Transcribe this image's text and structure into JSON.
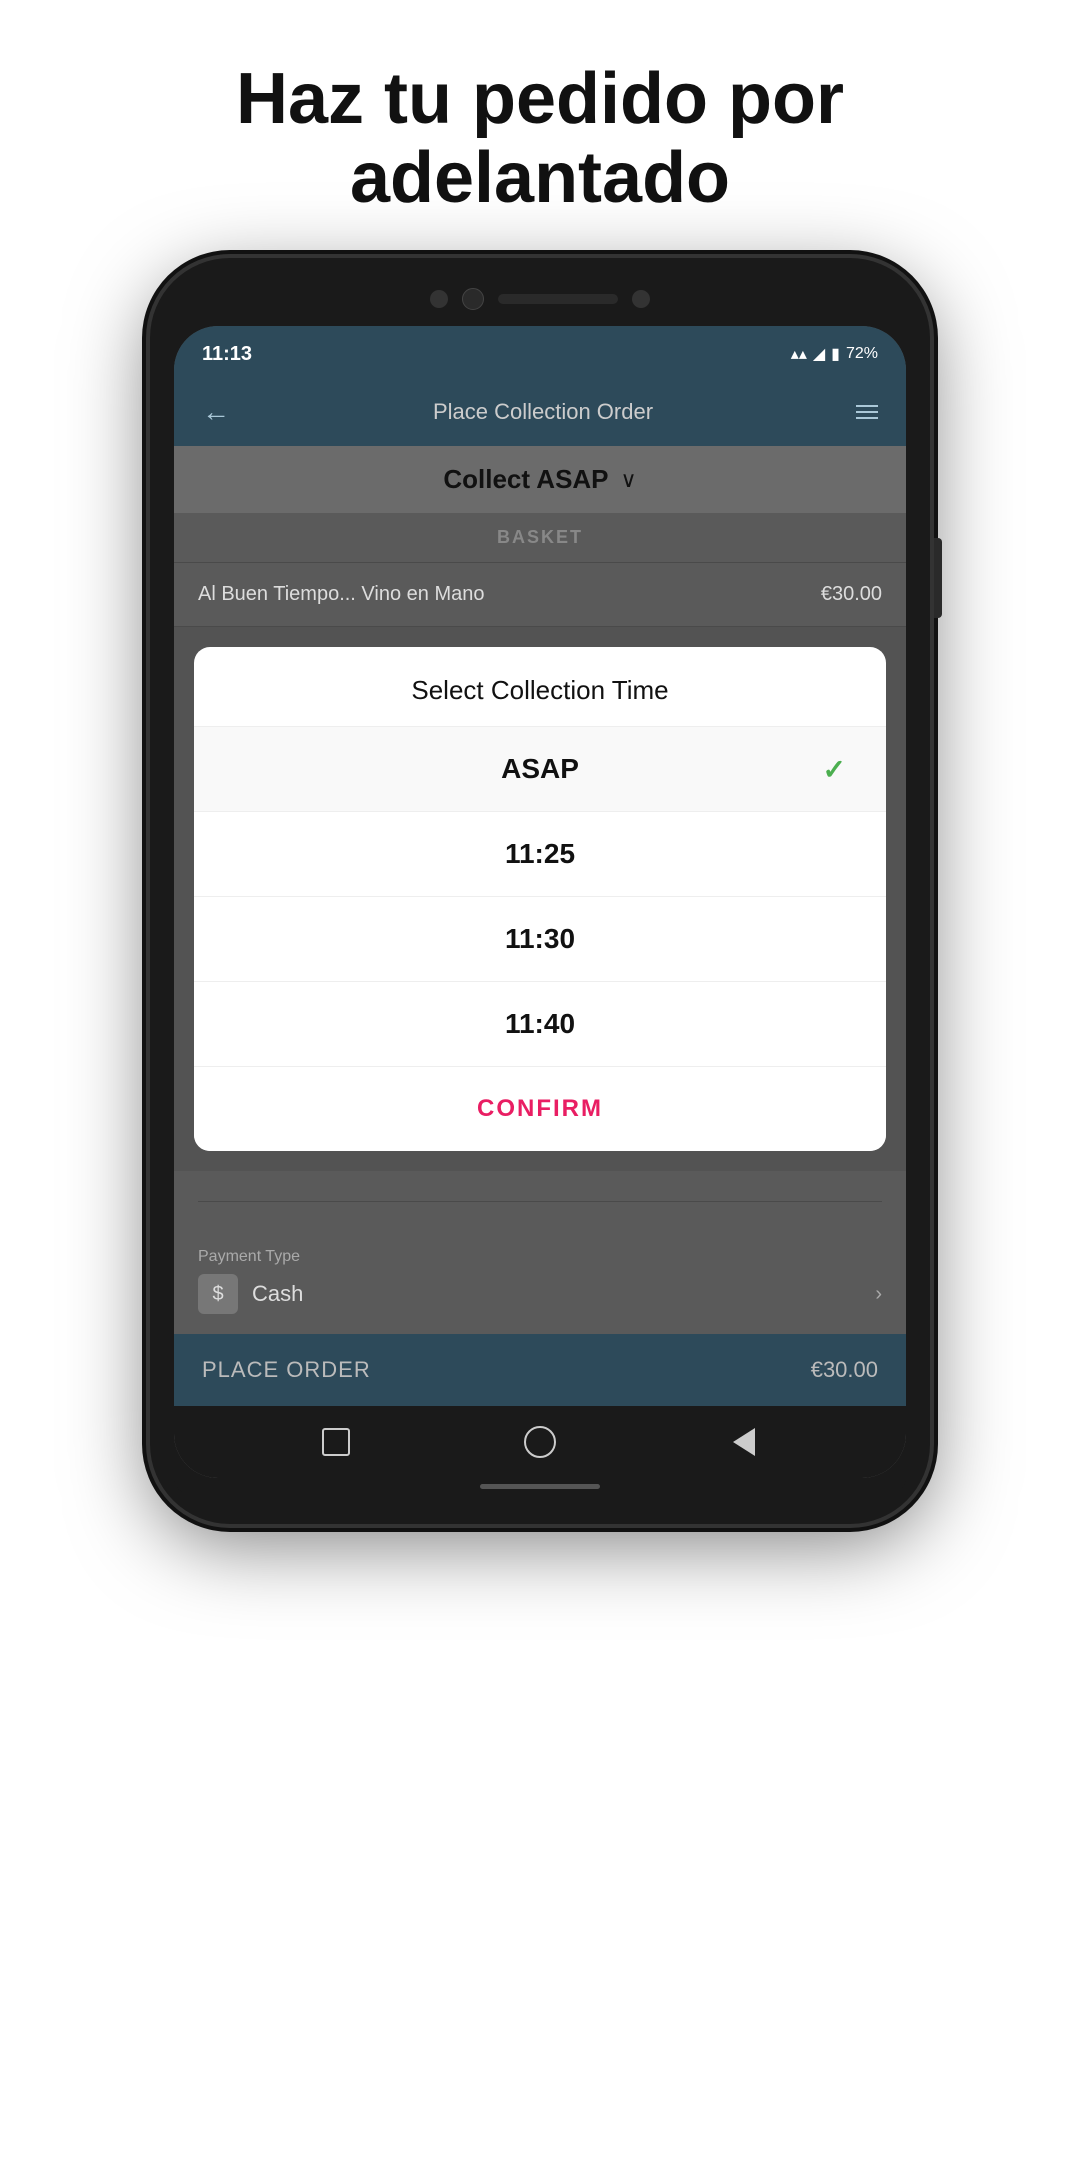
{
  "page": {
    "headline": "Haz tu pedido por adelantado"
  },
  "statusBar": {
    "time": "11:13",
    "battery": "72%"
  },
  "navbar": {
    "title": "Place Collection Order",
    "backLabel": "←",
    "menuLabel": "≡"
  },
  "collectBar": {
    "label": "Collect ASAP",
    "chevron": "∨"
  },
  "basket": {
    "header": "BASKET",
    "item": {
      "name": "Al Buen Tiempo... Vino en Mano",
      "price": "€30.00"
    }
  },
  "modal": {
    "title": "Select Collection Time",
    "options": [
      {
        "label": "ASAP",
        "selected": true
      },
      {
        "label": "11:25",
        "selected": false
      },
      {
        "label": "11:30",
        "selected": false
      },
      {
        "label": "11:40",
        "selected": false
      }
    ],
    "confirmLabel": "CONFIRM"
  },
  "payment": {
    "sectionLabel": "Payment Type",
    "method": "Cash"
  },
  "placeOrder": {
    "label": "PLACE ORDER",
    "price": "€30.00"
  }
}
